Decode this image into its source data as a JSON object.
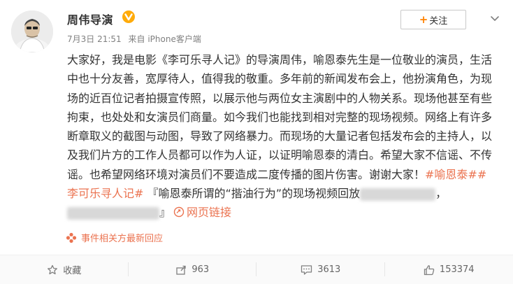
{
  "user": {
    "name": "周伟导演",
    "badge_color": "#ffab0a"
  },
  "meta": {
    "time": "7月3日 21:51",
    "source": "来自 iPhone客户端"
  },
  "follow": {
    "label": "关注"
  },
  "post": {
    "text": "大家好，我是电影《李可乐寻人记》的导演周伟，喻恩泰先生是一位敬业的演员，生活中也十分友善，宽厚待人，值得我的敬重。多年前的新闻发布会上，他扮演角色，为现场的近百位记者拍摄宣传照，以展示他与两位女主演剧中的人物关系。现场他甚至有些拘束，也处处和女演员们商量。如今我们也能找到相对完整的现场视频。网络上有许多断章取义的截图与动图，导致了网络暴力。而现场的大量记者包括发布会的主持人，以及我们片方的工作人员都可以作为人证，以证明喻恩泰的清白。希望大家不信谣、不传谣。也希望网络环境对演员们不要造成二度传播的图片伤害。谢谢大家！",
    "hashtag1": "#喻恩泰#",
    "hashtag2": "#李可乐寻人记#",
    "quote_text": "『喻恩泰所谓的“揩油行为”的现场视频回放",
    "quote_end": "』",
    "link_label": "网页链接",
    "link_color": "#eb7350"
  },
  "event": {
    "label": "事件相关方最新回应"
  },
  "actions": {
    "favorite": "收藏",
    "repost": "963",
    "comment": "3613",
    "like": "153374"
  }
}
